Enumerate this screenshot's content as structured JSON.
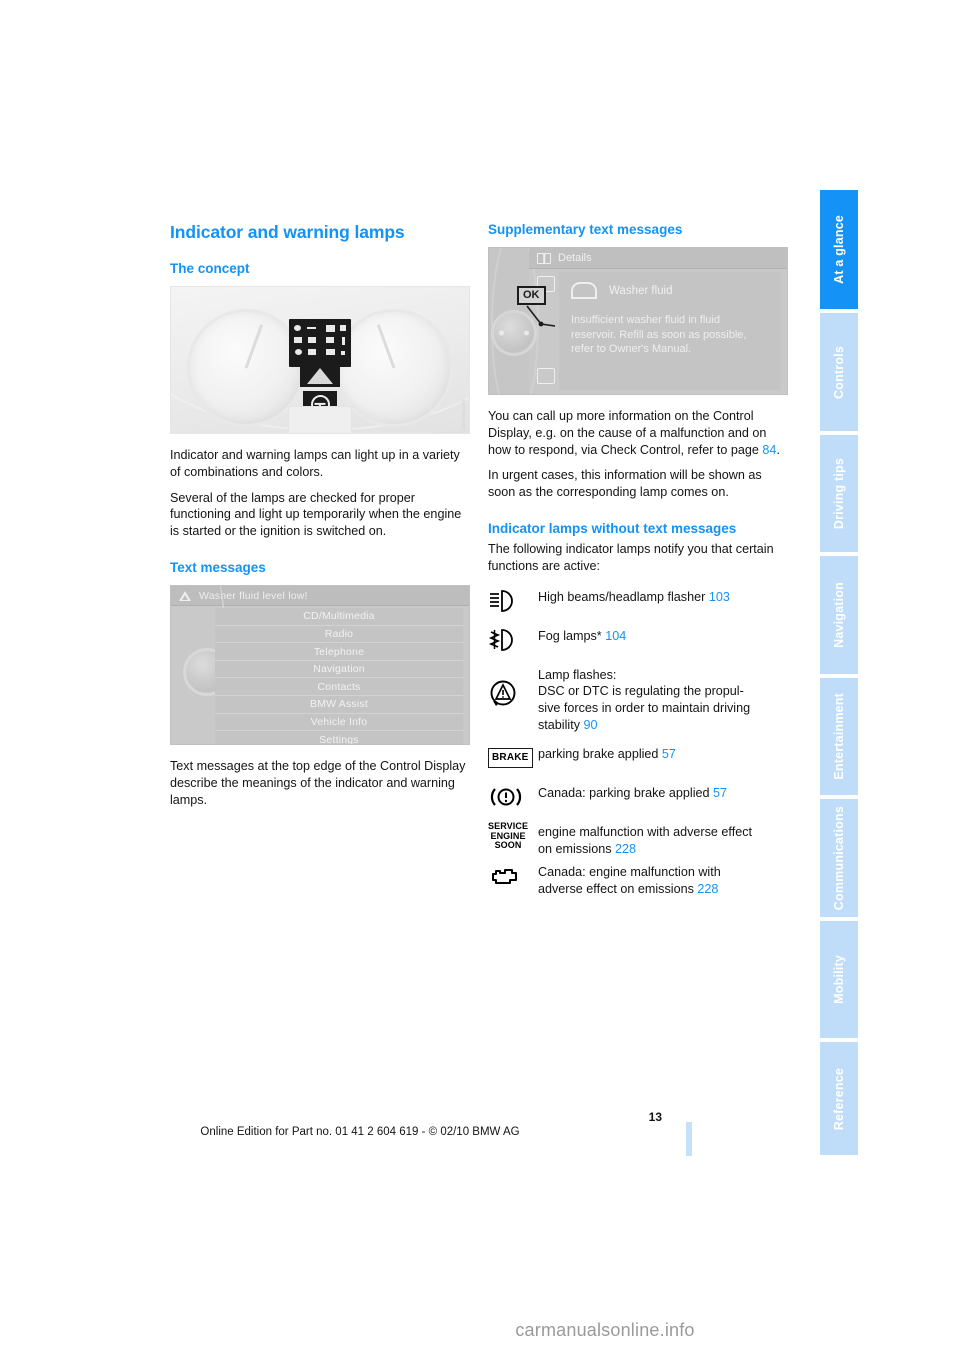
{
  "document": {
    "page_number": "13",
    "footer_edition": "Online Edition for Part no. 01 41 2 604 619 - © 02/10 BMW AG",
    "watermark": "carmanualsonline.info"
  },
  "colors": {
    "heading_blue": "#1492f5",
    "tab_active": "#1492f5",
    "tab_inactive": "#bfdcf8",
    "link_blue": "#1492f5",
    "body_text": "#141414"
  },
  "sidebar": {
    "tabs": [
      {
        "label": "At a glance",
        "active": true
      },
      {
        "label": "Controls",
        "active": false
      },
      {
        "label": "Driving tips",
        "active": false
      },
      {
        "label": "Navigation",
        "active": false
      },
      {
        "label": "Entertainment",
        "active": false
      },
      {
        "label": "Communications",
        "active": false
      },
      {
        "label": "Mobility",
        "active": false
      },
      {
        "label": "Reference",
        "active": false
      }
    ]
  },
  "left_column": {
    "section_title": "Indicator and warning lamps",
    "concept": {
      "heading": "The concept",
      "figure_caption": "instrument-cluster-photo",
      "paragraph_1": "Indicator and warning lamps can light up in a variety of combinations and colors.",
      "paragraph_2": "Several of the lamps are checked for proper functioning and light up temporarily when the engine is started or the ignition is switched on."
    },
    "text_messages": {
      "heading": "Text messages",
      "screen": {
        "status_message": "Washer fluid level low!",
        "menu_items": [
          "CD/Multimedia",
          "Radio",
          "Telephone",
          "Navigation",
          "Contacts",
          "BMW Assist",
          "Vehicle Info",
          "Settings"
        ]
      },
      "paragraph": "Text messages at the top edge of the Control Display describe the meanings of the indicator and warning lamps."
    }
  },
  "right_column": {
    "supplementary": {
      "heading": "Supplementary text messages",
      "screen": {
        "title": "Details",
        "ok_button": "OK",
        "item_title": "Washer fluid",
        "item_body": "Insufficient washer fluid in fluid reservoir. Refill as soon as possible, refer to Owner's Manual."
      },
      "paragraph_1_a": "You can call up more information on the Control Display, e.g. on the cause of a malfunction and on how to respond, via Check Control, refer to page ",
      "paragraph_1_page": "84",
      "paragraph_1_b": ".",
      "paragraph_2": "In urgent cases, this information will be shown as soon as the corresponding lamp comes on."
    },
    "indicator_lamps": {
      "heading": "Indicator lamps without text messages",
      "intro": "The following indicator lamps notify you that certain functions are active:",
      "rows": [
        {
          "icon": "high-beam-icon",
          "text": "High beams/headlamp flasher",
          "page": "103"
        },
        {
          "icon": "fog-lamp-icon",
          "text": "Fog lamps*",
          "page": "104"
        },
        {
          "icon": "dsc-warning-icon",
          "text": "Lamp flashes:\nDSC or DTC is regulating the propulsive forces in order to maintain driving stability",
          "page": "90"
        },
        {
          "icon": "brake-text-icon",
          "text": "parking brake applied",
          "page": "57"
        },
        {
          "icon": "brake-circle-icon",
          "text": "Canada: parking brake applied",
          "page": "57"
        },
        {
          "icon": "service-engine-soon-icon",
          "text": "engine malfunction with adverse effect on emissions",
          "page": "228"
        },
        {
          "icon": "check-engine-icon",
          "text": "Canada: engine malfunction with adverse effect on emissions",
          "page": "228"
        }
      ]
    }
  }
}
